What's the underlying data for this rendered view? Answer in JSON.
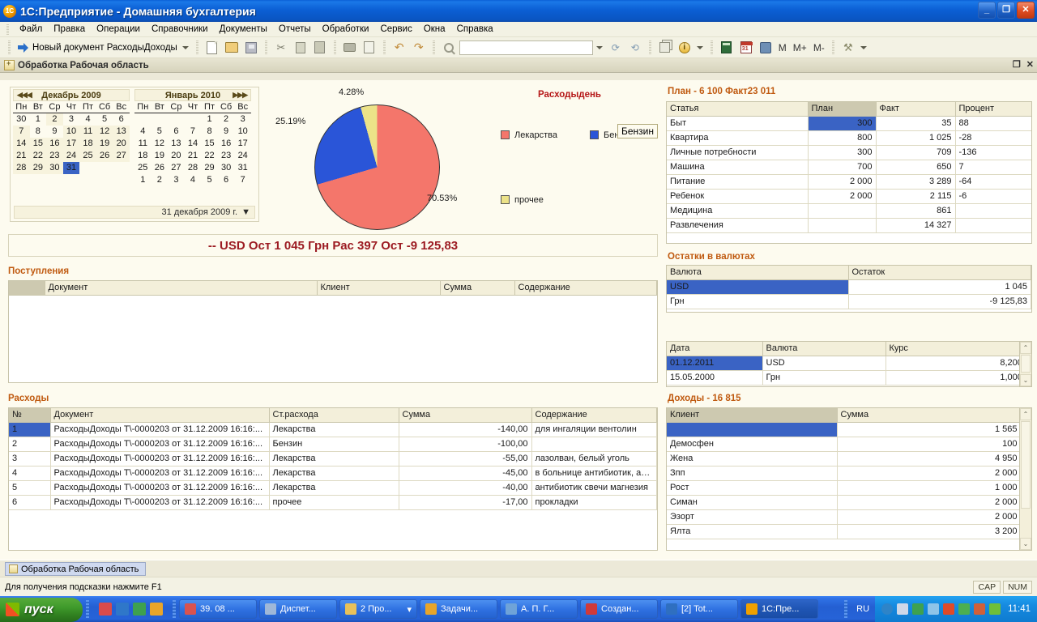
{
  "window": {
    "title": "1С:Предприятие - Домашняя бухгалтерия",
    "app_icon": "1c-logo-icon",
    "minimize": "_",
    "restore": "❐",
    "close": "✕"
  },
  "menubar": [
    {
      "label": "Файл"
    },
    {
      "label": "Правка"
    },
    {
      "label": "Операции"
    },
    {
      "label": "Справочники"
    },
    {
      "label": "Документы"
    },
    {
      "label": "Отчеты"
    },
    {
      "label": "Обработки"
    },
    {
      "label": "Сервис"
    },
    {
      "label": "Окна"
    },
    {
      "label": "Справка"
    }
  ],
  "toolbar": {
    "new_doc_label": "Новый документ РасходыДоходы",
    "search_value": "",
    "m_label": "M",
    "mplus_label": "M+",
    "mminus_label": "M-"
  },
  "mdi": {
    "title": "Обработка  Рабочая область",
    "restore": "❐",
    "close": "✕"
  },
  "calendar": {
    "left": {
      "title": "Декабрь 2009",
      "nav": "◀◀◀",
      "weekdays": [
        "Пн",
        "Вт",
        "Ср",
        "Чт",
        "Пт",
        "Сб",
        "Вс"
      ],
      "weeks": [
        [
          {
            "d": "30",
            "t": "out"
          },
          {
            "d": "1"
          },
          {
            "d": "2",
            "t": "shade"
          },
          {
            "d": "3"
          },
          {
            "d": "4"
          },
          {
            "d": "5",
            "t": "wknd"
          },
          {
            "d": "6",
            "t": "wknd"
          }
        ],
        [
          {
            "d": "7",
            "t": "shade"
          },
          {
            "d": "8"
          },
          {
            "d": "9"
          },
          {
            "d": "10",
            "t": "shade"
          },
          {
            "d": "11",
            "t": "shade"
          },
          {
            "d": "12",
            "t": "wknd shade"
          },
          {
            "d": "13",
            "t": "wknd shade"
          }
        ],
        [
          {
            "d": "14",
            "t": "shade"
          },
          {
            "d": "15",
            "t": "shade"
          },
          {
            "d": "16",
            "t": "shade"
          },
          {
            "d": "17",
            "t": "shade"
          },
          {
            "d": "18",
            "t": "shade"
          },
          {
            "d": "19",
            "t": "wknd shade"
          },
          {
            "d": "20",
            "t": "wknd shade"
          }
        ],
        [
          {
            "d": "21",
            "t": "shade"
          },
          {
            "d": "22",
            "t": "shade"
          },
          {
            "d": "23",
            "t": "shade"
          },
          {
            "d": "24",
            "t": "shade"
          },
          {
            "d": "25",
            "t": "shade"
          },
          {
            "d": "26",
            "t": "wknd shade"
          },
          {
            "d": "27",
            "t": "wknd shade"
          }
        ],
        [
          {
            "d": "28",
            "t": "shade"
          },
          {
            "d": "29",
            "t": "shade"
          },
          {
            "d": "30",
            "t": "shade"
          },
          {
            "d": "31",
            "t": "sel"
          },
          {
            "d": ""
          },
          {
            "d": ""
          },
          {
            "d": ""
          }
        ]
      ]
    },
    "right": {
      "title": "Январь 2010",
      "nav": "▶▶▶",
      "weekdays": [
        "Пн",
        "Вт",
        "Ср",
        "Чт",
        "Пт",
        "Сб",
        "Вс"
      ],
      "weeks": [
        [
          {
            "d": ""
          },
          {
            "d": ""
          },
          {
            "d": ""
          },
          {
            "d": ""
          },
          {
            "d": "1"
          },
          {
            "d": "2",
            "t": "wknd"
          },
          {
            "d": "3",
            "t": "wknd"
          }
        ],
        [
          {
            "d": "4"
          },
          {
            "d": "5"
          },
          {
            "d": "6"
          },
          {
            "d": "7"
          },
          {
            "d": "8"
          },
          {
            "d": "9",
            "t": "wknd"
          },
          {
            "d": "10",
            "t": "wknd"
          }
        ],
        [
          {
            "d": "11"
          },
          {
            "d": "12"
          },
          {
            "d": "13"
          },
          {
            "d": "14"
          },
          {
            "d": "15"
          },
          {
            "d": "16",
            "t": "wknd"
          },
          {
            "d": "17",
            "t": "wknd"
          }
        ],
        [
          {
            "d": "18"
          },
          {
            "d": "19"
          },
          {
            "d": "20"
          },
          {
            "d": "21"
          },
          {
            "d": "22"
          },
          {
            "d": "23",
            "t": "wknd"
          },
          {
            "d": "24",
            "t": "wknd"
          }
        ],
        [
          {
            "d": "25"
          },
          {
            "d": "26"
          },
          {
            "d": "27"
          },
          {
            "d": "28"
          },
          {
            "d": "29"
          },
          {
            "d": "30",
            "t": "wknd"
          },
          {
            "d": "31",
            "t": "wknd"
          }
        ],
        [
          {
            "d": "1",
            "t": "out"
          },
          {
            "d": "2",
            "t": "out"
          },
          {
            "d": "3",
            "t": "out"
          },
          {
            "d": "4",
            "t": "out"
          },
          {
            "d": "5",
            "t": "out"
          },
          {
            "d": "6",
            "t": "out"
          },
          {
            "d": "7",
            "t": "out"
          }
        ]
      ]
    },
    "selected_date_label": "31 декабря 2009 г.",
    "dropdown_glyph": "▼"
  },
  "chart_data": {
    "type": "pie",
    "title": "Расходыдень",
    "title_color": "#b51616",
    "categories": [
      "Лекарства",
      "Бензин",
      "прочее"
    ],
    "values": [
      70.53,
      25.19,
      4.28
    ],
    "value_labels": [
      "70.53%",
      "25.19%",
      "4.28%"
    ],
    "colors": [
      "#f4766b",
      "#2a55d8",
      "#ece288"
    ],
    "legend": [
      {
        "label": "Лекарства",
        "color": "#f4766b"
      },
      {
        "label": "Бензи",
        "color": "#2a55d8"
      },
      {
        "label": "прочее",
        "color": "#ece288"
      }
    ],
    "legend_position": "right",
    "tooltip": "Бензин"
  },
  "summary_bar": {
    "text": "-- USD Ост 1 045 Грн Рас 397 Ост -9 125,83"
  },
  "plan_fact": {
    "title": "План - 6 100 Факт23 011",
    "columns": [
      "Статья",
      "План",
      "Факт",
      "Процент"
    ],
    "selected_column": "План",
    "rows": [
      {
        "article": "Быт",
        "plan": "300",
        "fact": "35",
        "percent": "88",
        "selected": true
      },
      {
        "article": "Квартира",
        "plan": "800",
        "fact": "1 025",
        "percent": "-28"
      },
      {
        "article": "Личные потребности",
        "plan": "300",
        "fact": "709",
        "percent": "-136"
      },
      {
        "article": "Машина",
        "plan": "700",
        "fact": "650",
        "percent": "7"
      },
      {
        "article": "Питание",
        "plan": "2 000",
        "fact": "3 289",
        "percent": "-64"
      },
      {
        "article": "Ребенок",
        "plan": "2 000",
        "fact": "2 115",
        "percent": "-6"
      },
      {
        "article": "Медицина",
        "plan": "",
        "fact": "861",
        "percent": ""
      },
      {
        "article": "Развлечения",
        "plan": "",
        "fact": "14 327",
        "percent": ""
      }
    ]
  },
  "postupleniya": {
    "title": "Поступления",
    "columns": [
      "",
      "Документ",
      "Клиент",
      "Сумма",
      "Содержание"
    ],
    "rows": []
  },
  "ostatki": {
    "title": "Остатки  в валютах",
    "columns": [
      "Валюта",
      "Остаток"
    ],
    "rows": [
      {
        "currency": "USD",
        "balance": "1 045",
        "selected": true
      },
      {
        "currency": "Грн",
        "balance": "-9 125,83"
      }
    ]
  },
  "kursy": {
    "columns": [
      "Дата",
      "Валюта",
      "Курс"
    ],
    "rows": [
      {
        "date": "01.12.2011",
        "currency": "USD",
        "rate": "8,2000",
        "selected": true
      },
      {
        "date": "15.05.2000",
        "currency": "Грн",
        "rate": "1,0000"
      }
    ],
    "scroll_up": "⌃",
    "scroll_down": "⌄"
  },
  "rashody": {
    "title": "Расходы",
    "columns": [
      "№",
      "Документ",
      "Ст.расхода",
      "Сумма",
      "Содержание"
    ],
    "rows": [
      {
        "n": "1",
        "doc": "РасходыДоходы Т\\-0000203 от 31.12.2009 16:16:...",
        "item": "Лекарства",
        "sum": "-140,00",
        "note": "для ингаляции вентолин",
        "selected": true
      },
      {
        "n": "2",
        "doc": "РасходыДоходы Т\\-0000203 от 31.12.2009 16:16:...",
        "item": "Бензин",
        "sum": "-100,00",
        "note": ""
      },
      {
        "n": "3",
        "doc": "РасходыДоходы Т\\-0000203 от 31.12.2009 16:16:...",
        "item": "Лекарства",
        "sum": "-55,00",
        "note": "лазолван, белый уголь"
      },
      {
        "n": "4",
        "doc": "РасходыДоходы Т\\-0000203 от 31.12.2009 16:16:...",
        "item": "Лекарства",
        "sum": "-45,00",
        "note": "в больнице антибиотик, ана..."
      },
      {
        "n": "5",
        "doc": "РасходыДоходы Т\\-0000203 от 31.12.2009 16:16:...",
        "item": "Лекарства",
        "sum": "-40,00",
        "note": "антибиотик свечи магнезия"
      },
      {
        "n": "6",
        "doc": "РасходыДоходы Т\\-0000203 от 31.12.2009 16:16:...",
        "item": "прочее",
        "sum": "-17,00",
        "note": "прокладки"
      }
    ]
  },
  "dohody": {
    "title": "Доходы - 16 815",
    "columns": [
      "Клиент",
      "Сумма"
    ],
    "rows": [
      {
        "client": "",
        "sum": "1 565",
        "selected": true
      },
      {
        "client": "Демосфен",
        "sum": "100"
      },
      {
        "client": "Жена",
        "sum": "4 950"
      },
      {
        "client": "Зпп",
        "sum": "2 000"
      },
      {
        "client": "Рост",
        "sum": "1 000"
      },
      {
        "client": "Симан",
        "sum": "2 000"
      },
      {
        "client": "Эзорт",
        "sum": "2 000"
      },
      {
        "client": "Ялта",
        "sum": "3 200"
      }
    ],
    "scroll_up": "⌃",
    "scroll_down": "⌄"
  },
  "window_tab": {
    "label": "Обработка  Рабочая область"
  },
  "statusbar": {
    "hint": "Для получения подсказки нажмите F1",
    "caps": "CAP",
    "num": "NUM"
  },
  "taskbar": {
    "start_label": "пуск",
    "quick_launch": [
      {
        "name": "floppy-icon",
        "color": "#d94b4b"
      },
      {
        "name": "ie-icon",
        "color": "#2f77c9"
      },
      {
        "name": "media-icon",
        "color": "#3ea14f"
      },
      {
        "name": "clock-icon",
        "color": "#e8a52a"
      }
    ],
    "buttons": [
      {
        "label": "39. 08 ...",
        "icon_color": "#d9534f",
        "active": false,
        "dropdown": false
      },
      {
        "label": "Диспет...",
        "icon_color": "#9fb8d8",
        "active": false,
        "dropdown": false
      },
      {
        "label": "2 Про...",
        "icon_color": "#e8c15a",
        "active": false,
        "dropdown": true
      },
      {
        "label": "Задачи...",
        "icon_color": "#e8a52a",
        "active": false,
        "dropdown": false
      },
      {
        "label": "А. П. Г...",
        "icon_color": "#6fa3d8",
        "active": false,
        "dropdown": false
      },
      {
        "label": "Создан...",
        "icon_color": "#d03a3a",
        "active": false,
        "dropdown": false
      },
      {
        "label": "[2] Tot...",
        "icon_color": "#2f6fc0",
        "active": false,
        "dropdown": false
      },
      {
        "label": "1C:Пре...",
        "icon_color": "#f0a000",
        "active": true,
        "dropdown": false
      }
    ],
    "language": "RU",
    "tray_icons": [
      {
        "name": "back-arrow-icon",
        "color": "#2e84c8"
      },
      {
        "name": "network-icon",
        "color": "#cfd8e8"
      },
      {
        "name": "monitor-icon",
        "color": "#3ea14f"
      },
      {
        "name": "shield-icon",
        "color": "#8ec4e8"
      },
      {
        "name": "opera-icon",
        "color": "#e04a28"
      },
      {
        "name": "check-icon",
        "color": "#4caf50"
      },
      {
        "name": "speed-icon",
        "color": "#d0603a"
      },
      {
        "name": "signal-icon",
        "color": "#6fbf3a"
      }
    ],
    "clock": "11:41"
  }
}
